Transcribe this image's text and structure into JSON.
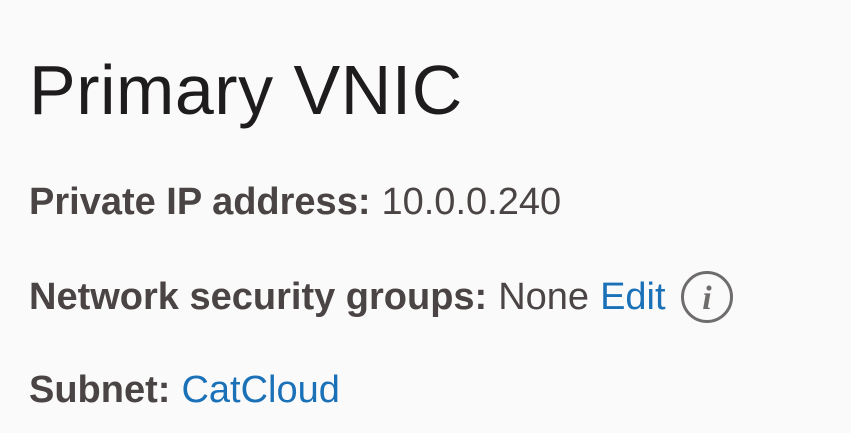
{
  "vnic": {
    "title": "Primary VNIC",
    "private_ip": {
      "label": "Private IP address:",
      "value": "10.0.0.240"
    },
    "nsg": {
      "label": "Network security groups:",
      "value": "None",
      "edit_label": "Edit",
      "info_icon": "info-icon"
    },
    "subnet": {
      "label": "Subnet:",
      "link_text": "CatCloud"
    }
  },
  "colors": {
    "text": "#4a4544",
    "title": "#1e1c1c",
    "link": "#1b71b8",
    "icon": "#6f6c6c",
    "background": "#fbfafa"
  }
}
